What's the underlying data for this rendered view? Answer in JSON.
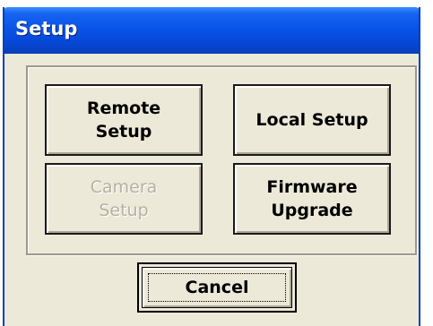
{
  "window": {
    "title": "Setup"
  },
  "buttons": {
    "remote_setup": "Remote\nSetup",
    "local_setup": "Local Setup",
    "camera_setup": "Camera\nSetup",
    "firmware_upgrade": "Firmware\nUpgrade",
    "cancel": "Cancel"
  },
  "states": {
    "camera_setup_enabled": false,
    "focused_button": "cancel"
  },
  "colors": {
    "titlebar": "#0a54e8",
    "dialog_background": "#ece9d8",
    "disabled_text": "#b3b1a4"
  }
}
